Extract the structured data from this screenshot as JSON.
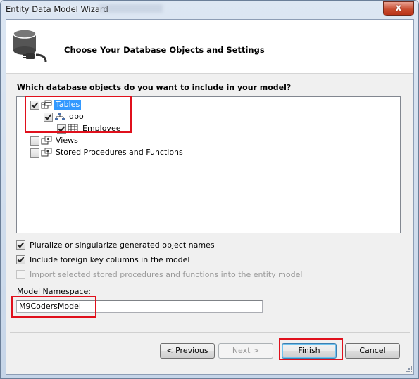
{
  "window": {
    "title": "Entity Data Model Wizard",
    "close_symbol": "x"
  },
  "header": {
    "title": "Choose Your Database Objects and Settings"
  },
  "main": {
    "question": "Which database objects do you want to include in your model?",
    "tree": {
      "tables": {
        "label": "Tables",
        "checked": true
      },
      "dbo": {
        "label": "dbo",
        "checked": true
      },
      "employee": {
        "label": "Employee",
        "checked": true
      },
      "views": {
        "label": "Views",
        "checked": false
      },
      "procs": {
        "label": "Stored Procedures and Functions",
        "checked": false
      }
    },
    "options": {
      "pluralize": {
        "label": "Pluralize or singularize generated object names",
        "checked": true
      },
      "foreign_keys": {
        "label": "Include foreign key columns in the model",
        "checked": true
      },
      "import_procs": {
        "label": "Import selected stored procedures and functions into the entity model",
        "checked": false,
        "disabled": true
      }
    },
    "namespace": {
      "label": "Model Namespace:",
      "value": "M9CodersModel"
    }
  },
  "buttons": {
    "previous": "< Previous",
    "next": "Next >",
    "finish": "Finish",
    "cancel": "Cancel"
  },
  "colors": {
    "highlight_box": "#e0101c",
    "selection": "#3399ff"
  },
  "icons": [
    "database-plug-icon",
    "tables-icon",
    "schema-icon",
    "table-icon",
    "views-icon",
    "procedures-icon",
    "close-icon"
  ]
}
